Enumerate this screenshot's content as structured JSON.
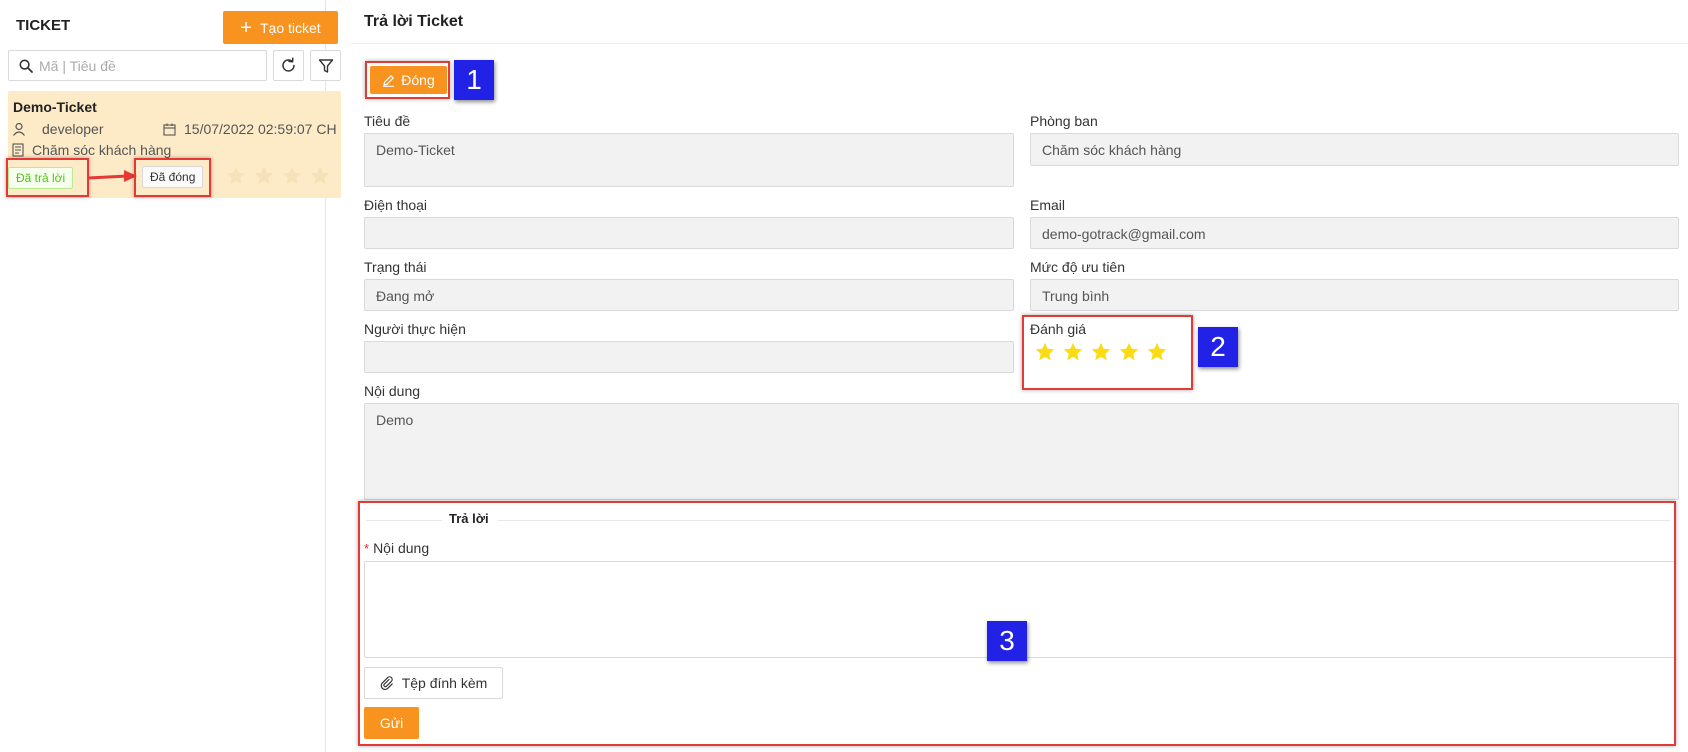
{
  "sidebar": {
    "title": "TICKET",
    "create_button": "Tạo ticket",
    "search_placeholder": "Mã | Tiêu đề",
    "ticket": {
      "title": "Demo-Ticket",
      "user": "developer",
      "datetime": "15/07/2022 02:59:07 CH",
      "department": "Chăm sóc khách hàng",
      "status_replied": "Đã trả lời",
      "status_closed": "Đã đóng",
      "rating": 0
    }
  },
  "main": {
    "page_title": "Trả lời Ticket",
    "close_button": "Đóng",
    "fields": {
      "title_label": "Tiêu đề",
      "title_value": "Demo-Ticket",
      "department_label": "Phòng ban",
      "department_value": "Chăm sóc khách hàng",
      "phone_label": "Điện thoại",
      "phone_value": "",
      "email_label": "Email",
      "email_value": "demo-gotrack@gmail.com",
      "status_label": "Trạng thái",
      "status_value": "Đang mở",
      "priority_label": "Mức độ ưu tiên",
      "priority_value": "Trung bình",
      "assignee_label": "Người thực hiện",
      "assignee_value": "",
      "rating_label": "Đánh giá",
      "rating_value": 5,
      "content_label": "Nội dung",
      "content_value": "Demo"
    },
    "reply": {
      "section_title": "Trả lời",
      "required_mark": "*",
      "content_label": "Nội dung",
      "content_value": "",
      "attach_button": "Tệp đính kèm",
      "send_button": "Gửi"
    }
  },
  "annotations": {
    "one": "1",
    "two": "2",
    "three": "3"
  },
  "colors": {
    "accent": "#f7931e",
    "card_bg": "#fdebc8",
    "annotation_red": "#e53935",
    "annotation_blue": "#2222e6",
    "star_gold": "#fadb14"
  }
}
